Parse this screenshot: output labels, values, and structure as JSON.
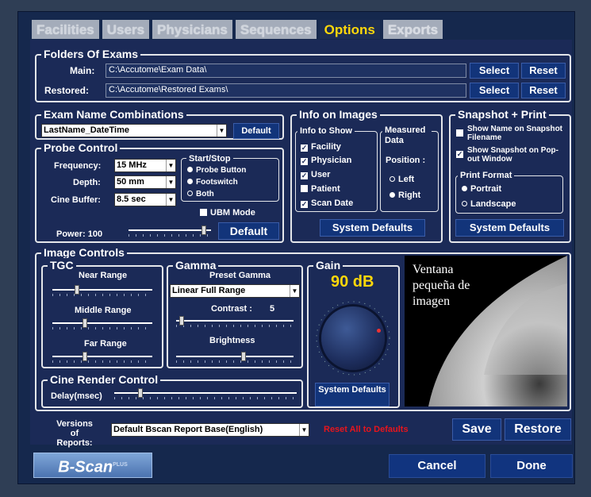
{
  "tabs": [
    "Facilities",
    "Users",
    "Physicians",
    "Sequences",
    "Options",
    "Exports"
  ],
  "active_tab": "Options",
  "folders": {
    "title": "Folders Of Exams",
    "main_label": "Main:",
    "main_value": "C:\\Accutome\\Exam Data\\",
    "restored_label": "Restored:",
    "restored_value": "C:\\Accutome\\Restored Exams\\",
    "select": "Select",
    "reset": "Reset"
  },
  "exam_names": {
    "title": "Exam Name Combinations",
    "value": "LastName_DateTime",
    "default": "Default"
  },
  "probe": {
    "title": "Probe Control",
    "frequency_label": "Frequency:",
    "frequency": "15 MHz",
    "depth_label": "Depth:",
    "depth": "50 mm",
    "cine_label": "Cine Buffer:",
    "cine": "8.5 sec",
    "startstop_title": "Start/Stop",
    "opt1": "Probe Button",
    "opt2": "Footswitch",
    "opt3": "Both",
    "ubm": "UBM Mode",
    "power_label": "Power: 100",
    "power_value": 100,
    "default": "Default"
  },
  "info": {
    "title": "Info on Images",
    "show_title": "Info to Show",
    "facility": "Facility",
    "physician": "Physician",
    "user": "User",
    "patient": "Patient",
    "scan_date": "Scan Date",
    "measured_title": "Measured Data",
    "position_label": "Position :",
    "left": "Left",
    "right": "Right",
    "system_defaults": "System Defaults"
  },
  "snapshot": {
    "title": "Snapshot + Print",
    "opt1": "Show Name on Snapshot Filename",
    "opt2": "Show Snapshot on Pop-out Window",
    "format_title": "Print Format",
    "portrait": "Portrait",
    "landscape": "Landscape",
    "system_defaults": "System Defaults"
  },
  "image": {
    "title": "Image Controls",
    "tgc_title": "TGC",
    "near": "Near Range",
    "middle": "Middle Range",
    "far": "Far Range",
    "gamma_title": "Gamma",
    "preset_label": "Preset Gamma",
    "preset": "Linear Full Range",
    "contrast_label": "Contrast :",
    "contrast_value": "5",
    "brightness": "Brightness",
    "gain_title": "Gain",
    "gain": "90 dB",
    "system_defaults": "System Defaults",
    "window_text": "Ventana pequeña de imagen"
  },
  "cine": {
    "title": "Cine Render Control",
    "delay": "Delay(msec)"
  },
  "reports": {
    "label": "Versions of Reports:",
    "value": "Default Bscan Report Base(English)",
    "reset_all": "Reset All to Defaults",
    "save": "Save",
    "restore": "Restore"
  },
  "footer": {
    "logo": "B-Scan",
    "logo_sup": "PLUS",
    "cancel": "Cancel",
    "done": "Done"
  }
}
